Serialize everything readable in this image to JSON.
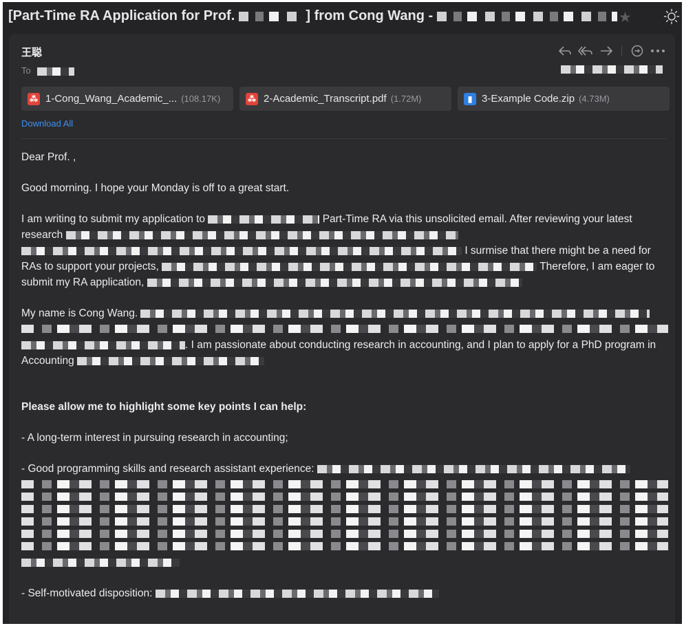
{
  "window": {
    "title": "[Part-Time RA Application for Prof.",
    "title_suffix": "] from Cong Wang -"
  },
  "icons": [
    "star-icon",
    "sun-icon",
    "reply-icon",
    "reply-all-icon",
    "forward-icon",
    "summarize-icon",
    "more-icon",
    "pdf-icon",
    "zip-icon"
  ],
  "message": {
    "sender": "王聪",
    "to_label": "To"
  },
  "attachments": [
    {
      "name": "1-Cong_Wang_Academic_...",
      "size": "(108.17K)",
      "type": "pdf"
    },
    {
      "name": "2-Academic_Transcript.pdf",
      "size": "(1.72M)",
      "type": "pdf"
    },
    {
      "name": "3-Example Code.zip",
      "size": "(4.73M)",
      "type": "zip"
    }
  ],
  "download_all": "Download All",
  "body": {
    "greeting": "Dear Prof.    ,",
    "p1": "Good morning. I hope your Monday is off to a great start.",
    "p2a": "I am writing to submit my application to",
    "p2b": "Part-Time RA via this unsolicited email. After reviewing your latest research",
    "p2c": "I surmise that there might be a need for RAs to support your projects,",
    "p2d": "Therefore, I am eager to submit my RA application,",
    "p3a": "My name is Cong Wang.",
    "p3b": ". I am passionate about conducting research in accounting, and I plan to apply for a PhD program in Accounting",
    "highlight_heading": "Please allow me to highlight some key points I can help:",
    "point1": "- A long-term interest in pursuing research in accounting;",
    "point2": "- Good programming skills and research assistant experience:",
    "point3": "- Self-motivated disposition:"
  },
  "colors": {
    "background": "#242426",
    "card": "#2b2b2e",
    "link": "#3f8ff0",
    "pdf_badge": "#e0443a",
    "zip_badge": "#2f7fe0"
  }
}
